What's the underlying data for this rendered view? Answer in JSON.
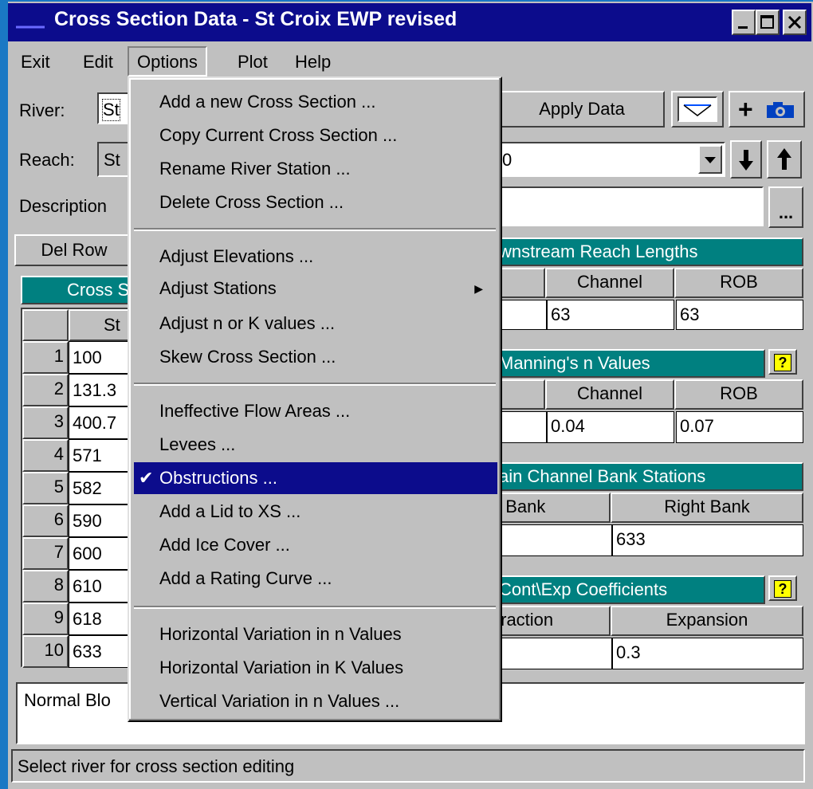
{
  "window": {
    "title": "Cross Section Data - St Croix EWP revised"
  },
  "menubar": [
    "Exit",
    "Edit",
    "Options",
    "Plot",
    "Help"
  ],
  "form": {
    "river_label": "River:",
    "river_value": "St",
    "reach_label": "Reach:",
    "reach_value": "St",
    "reach_station_fragment": "0",
    "description_label": "Description",
    "apply_label": "Apply Data",
    "del_row_label": "Del Row",
    "browse_label": "...",
    "add_photo_label": "+"
  },
  "table": {
    "title_fragment": "Cross S",
    "station_header_fragment": "St",
    "row_numbers": [
      "1",
      "2",
      "3",
      "4",
      "5",
      "6",
      "7",
      "8",
      "9",
      "10"
    ],
    "stations": [
      "100",
      "131.3",
      "400.7",
      "571",
      "582",
      "590",
      "600",
      "610",
      "618",
      "633"
    ]
  },
  "reach_lengths": {
    "title": "wnstream Reach Lengths",
    "channel_header": "Channel",
    "rob_header": "ROB",
    "channel_value": "63",
    "rob_value": "63"
  },
  "mannings": {
    "title": "Manning's n Values",
    "channel_header": "Channel",
    "rob_header": "ROB",
    "channel_value": "0.04",
    "rob_value": "0.07"
  },
  "bank_stations": {
    "title": "ain Channel Bank Stations",
    "left_header": ": Bank",
    "right_header": "Right Bank",
    "right_value": "633"
  },
  "coefficients": {
    "title": "Cont\\Exp  Coefficients",
    "contraction_header": "traction",
    "expansion_header": "Expansion",
    "expansion_value": "0.3"
  },
  "note_text": "Normal Blo",
  "status_text": "Select river for cross section editing",
  "options_menu": {
    "group1": [
      "Add a new Cross Section ...",
      "Copy Current Cross Section ...",
      "Rename River Station ...",
      "Delete Cross Section ..."
    ],
    "group2": [
      "Adjust Elevations ...",
      "Adjust Stations",
      "Adjust n or K values ...",
      "Skew Cross Section ..."
    ],
    "group3": [
      "Ineffective Flow Areas ...",
      "Levees ...",
      "Obstructions ...",
      "Add a Lid to XS ...",
      "Add Ice Cover ...",
      "Add a Rating Curve ..."
    ],
    "group4": [
      "Horizontal Variation in n Values",
      "Horizontal Variation in K Values",
      "Vertical Variation in n Values ..."
    ],
    "checkmark": "✔",
    "submenu_arrow": "▶"
  }
}
